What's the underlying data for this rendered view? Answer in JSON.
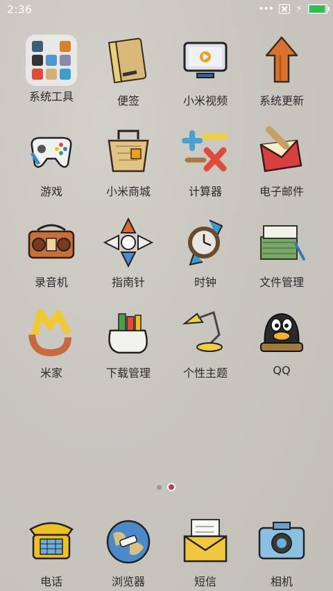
{
  "status": {
    "time": "2:36",
    "battery_level": 0.9
  },
  "grid": [
    {
      "label": "系统工具",
      "icon": "folder-icon"
    },
    {
      "label": "便签",
      "icon": "notes-icon"
    },
    {
      "label": "小米视频",
      "icon": "tv-video-icon"
    },
    {
      "label": "系统更新",
      "icon": "update-arrow-icon"
    },
    {
      "label": "游戏",
      "icon": "gamepad-icon"
    },
    {
      "label": "小米商城",
      "icon": "shopping-basket-icon"
    },
    {
      "label": "计算器",
      "icon": "calculator-icon"
    },
    {
      "label": "电子邮件",
      "icon": "mail-icon"
    },
    {
      "label": "录音机",
      "icon": "radio-recorder-icon"
    },
    {
      "label": "指南针",
      "icon": "compass-icon"
    },
    {
      "label": "时钟",
      "icon": "watch-icon"
    },
    {
      "label": "文件管理",
      "icon": "files-stack-icon"
    },
    {
      "label": "米家",
      "icon": "mijia-icon"
    },
    {
      "label": "下载管理",
      "icon": "download-sack-icon"
    },
    {
      "label": "个性主题",
      "icon": "desk-lamp-icon"
    },
    {
      "label": "QQ",
      "icon": "penguin-icon"
    }
  ],
  "dock": [
    {
      "label": "电话",
      "icon": "phone-icon"
    },
    {
      "label": "浏览器",
      "icon": "globe-icon"
    },
    {
      "label": "短信",
      "icon": "envelope-icon"
    },
    {
      "label": "相机",
      "icon": "camera-icon"
    }
  ],
  "pager": {
    "pages": 2,
    "current": 2
  }
}
